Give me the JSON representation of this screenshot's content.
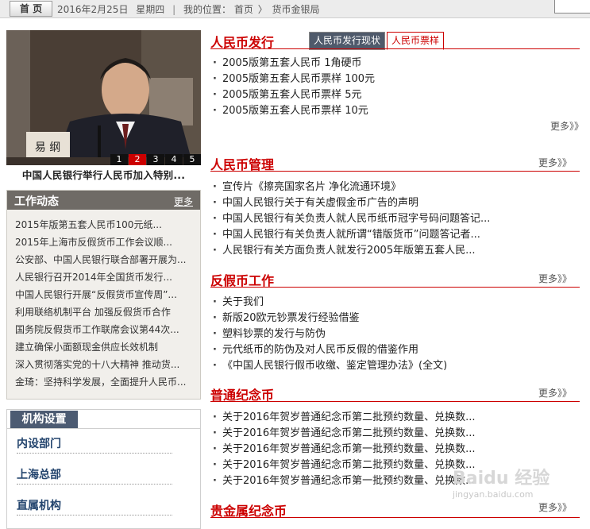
{
  "topbar": {
    "home_label": "首 页",
    "date": "2016年2月25日",
    "weekday": "星期四",
    "location_prefix": "我的位置：",
    "crumb_home": "首页",
    "crumb_sep": "〉",
    "crumb_current": "货币金银局"
  },
  "feature": {
    "nameplate": "易 纲",
    "slides": [
      "1",
      "2",
      "3",
      "4",
      "5"
    ],
    "caption": "中国人民银行举行人民币加入特别..."
  },
  "work": {
    "title": "工作动态",
    "more": "更多",
    "items": [
      "2015年版第五套人民币100元纸...",
      "2015年上海市反假货币工作会议顺...",
      "公安部、中国人民银行联合部署开展为...",
      "人民银行召开2014年全国货币发行...",
      "中国人民银行开展“反假货币宣传周”...",
      "利用联络机制平台 加强反假货币合作",
      "国务院反假货币工作联席会议第44次...",
      "建立确保小面额现金供应长效机制",
      "深入贯彻落实党的十八大精神 推动货...",
      "金琦：坚持科学发展，全面提升人民币..."
    ]
  },
  "org": {
    "title": "机构设置",
    "items": [
      "内设部门",
      "上海总部",
      "直属机构"
    ]
  },
  "sections": {
    "issuance": {
      "title": "人民币发行",
      "tab_status": "人民币发行现状",
      "tab_samples": "人民币票样",
      "more": "更多》》",
      "items": [
        "2005版第五套人民币 1角硬币",
        "2005版第五套人民币票样 100元",
        "2005版第五套人民币票样 5元",
        "2005版第五套人民币票样 10元"
      ]
    },
    "management": {
      "title": "人民币管理",
      "more": "更多》》",
      "items": [
        "宣传片《擦亮国家名片 净化流通环境》",
        "中国人民银行关于有关虚假金币广告的声明",
        "中国人民银行有关负责人就人民币纸币冠字号码问题答记...",
        "中国人民银行有关负责人就所谓“错版货币”问题答记者...",
        "人民银行有关方面负责人就发行2005年版第五套人民..."
      ]
    },
    "anticounterfeit": {
      "title": "反假币工作",
      "more": "更多》》",
      "items": [
        "关于我们",
        "新版20欧元钞票发行经验借鉴",
        "塑料钞票的发行与防伪",
        "元代纸币的防伪及对人民币反假的借鉴作用",
        "《中国人民银行假币收缴、鉴定管理办法》(全文)"
      ]
    },
    "commemorative": {
      "title": "普通纪念币",
      "more": "更多》》",
      "items": [
        "关于2016年贺岁普通纪念币第二批预约数量、兑换数...",
        "关于2016年贺岁普通纪念币第二批预约数量、兑换数...",
        "关于2016年贺岁普通纪念币第一批预约数量、兑换数...",
        "关于2016年贺岁普通纪念币第二批预约数量、兑换数...",
        "关于2016年贺岁普通纪念币第一批预约数量、兑换数..."
      ]
    },
    "precious": {
      "title": "贵金属纪念币",
      "more": "更多》》"
    }
  },
  "watermark": {
    "text": "Baidu 经验",
    "sub": "jingyan.baidu.com"
  }
}
